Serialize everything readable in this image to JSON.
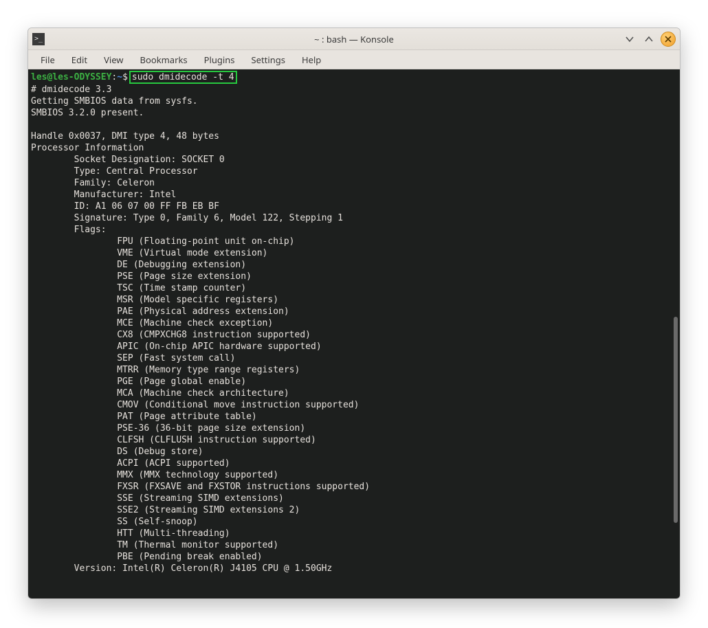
{
  "titlebar": {
    "app_icon_glyph": ">_",
    "title": "~ : bash — Konsole"
  },
  "menubar": {
    "file": "File",
    "edit": "Edit",
    "view": "View",
    "bookmarks": "Bookmarks",
    "plugins": "Plugins",
    "settings": "Settings",
    "help": "Help"
  },
  "prompt": {
    "userhost": "les@les-ODYSSEY",
    "sep": ":",
    "cwd": "~",
    "sigil": "$"
  },
  "command": "sudo dmidecode -t 4",
  "output_lines": [
    "# dmidecode 3.3",
    "Getting SMBIOS data from sysfs.",
    "SMBIOS 3.2.0 present.",
    "",
    "Handle 0x0037, DMI type 4, 48 bytes",
    "Processor Information",
    "        Socket Designation: SOCKET 0",
    "        Type: Central Processor",
    "        Family: Celeron",
    "        Manufacturer: Intel",
    "        ID: A1 06 07 00 FF FB EB BF",
    "        Signature: Type 0, Family 6, Model 122, Stepping 1",
    "        Flags:",
    "                FPU (Floating-point unit on-chip)",
    "                VME (Virtual mode extension)",
    "                DE (Debugging extension)",
    "                PSE (Page size extension)",
    "                TSC (Time stamp counter)",
    "                MSR (Model specific registers)",
    "                PAE (Physical address extension)",
    "                MCE (Machine check exception)",
    "                CX8 (CMPXCHG8 instruction supported)",
    "                APIC (On-chip APIC hardware supported)",
    "                SEP (Fast system call)",
    "                MTRR (Memory type range registers)",
    "                PGE (Page global enable)",
    "                MCA (Machine check architecture)",
    "                CMOV (Conditional move instruction supported)",
    "                PAT (Page attribute table)",
    "                PSE-36 (36-bit page size extension)",
    "                CLFSH (CLFLUSH instruction supported)",
    "                DS (Debug store)",
    "                ACPI (ACPI supported)",
    "                MMX (MMX technology supported)",
    "                FXSR (FXSAVE and FXSTOR instructions supported)",
    "                SSE (Streaming SIMD extensions)",
    "                SSE2 (Streaming SIMD extensions 2)",
    "                SS (Self-snoop)",
    "                HTT (Multi-threading)",
    "                TM (Thermal monitor supported)",
    "                PBE (Pending break enabled)",
    "        Version: Intel(R) Celeron(R) J4105 CPU @ 1.50GHz"
  ]
}
